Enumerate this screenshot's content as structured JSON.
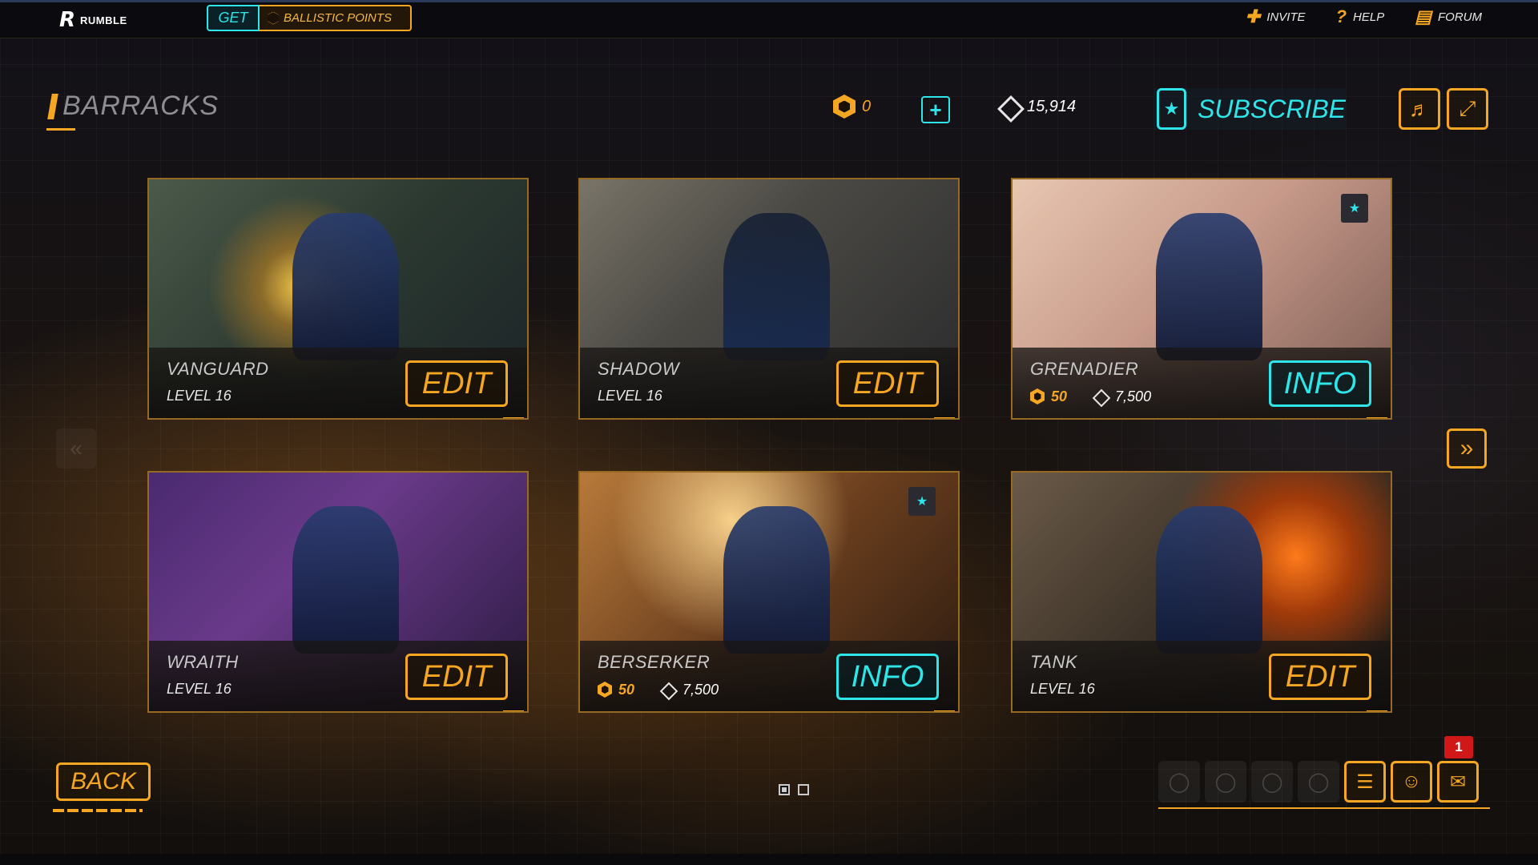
{
  "topbar": {
    "logo_mark": "R",
    "logo_text": "RUMBLE",
    "get_label": "GET",
    "ballistic_points_label": "BALLISTIC POINTS",
    "links": [
      {
        "label": "INVITE",
        "icon": "add-user-icon"
      },
      {
        "label": "HELP",
        "icon": "question-icon"
      },
      {
        "label": "FORUM",
        "icon": "chat-bubbles-icon"
      }
    ]
  },
  "header": {
    "title": "BARRACKS",
    "ballistic_points": "0",
    "credits": "15,914",
    "subscribe_label": "SUBSCRIBE"
  },
  "heroes": [
    {
      "name": "VANGUARD",
      "level": "LEVEL 16",
      "action": "EDIT",
      "owned": true
    },
    {
      "name": "SHADOW",
      "level": "LEVEL 16",
      "action": "EDIT",
      "owned": true
    },
    {
      "name": "GRENADIER",
      "price_bp": "50",
      "price_credits": "7,500",
      "action": "INFO",
      "owned": false
    },
    {
      "name": "WRAITH",
      "level": "LEVEL 16",
      "action": "EDIT",
      "owned": true
    },
    {
      "name": "BERSERKER",
      "price_bp": "50",
      "price_credits": "7,500",
      "action": "INFO",
      "owned": false
    },
    {
      "name": "TANK",
      "level": "LEVEL 16",
      "action": "EDIT",
      "owned": true
    }
  ],
  "footer": {
    "back_label": "BACK",
    "page_count": 2,
    "current_page": 1,
    "mail_badge": "1"
  },
  "colors": {
    "accent_orange": "#f5a623",
    "accent_cyan": "#2ee6ea",
    "badge_red": "#d01818"
  }
}
